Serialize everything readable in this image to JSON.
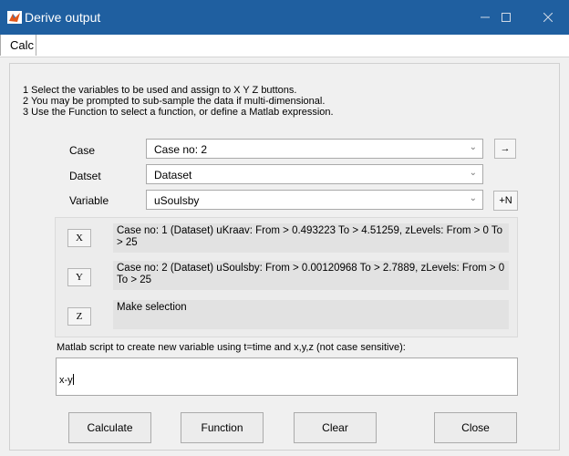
{
  "window": {
    "title": "Derive output",
    "app_icon": "matlab-icon",
    "controls": [
      "minimize-icon",
      "maximize-icon",
      "close-icon"
    ]
  },
  "menu": {
    "items": [
      {
        "label": "Calc"
      }
    ]
  },
  "instructions": [
    "1 Select the variables to be used and assign to X Y Z buttons.",
    "2 You may be prompted to sub-sample the data if multi-dimensional.",
    "3 Use the Function to select a function, or define a Matlab expression."
  ],
  "fields": {
    "case": {
      "label": "Case",
      "value": "Case no: 2",
      "action_label": "→"
    },
    "dataset": {
      "label": "Datset",
      "value": "Dataset"
    },
    "variable": {
      "label": "Variable",
      "value": "uSoulsby",
      "action_label": "+N"
    }
  },
  "xyz": [
    {
      "button": "X",
      "text": "Case no: 1 (Dataset) uKraav: From > 0.493223 To > 4.51259, zLevels: From > 0 To > 25"
    },
    {
      "button": "Y",
      "text": "Case no: 2 (Dataset) uSoulsby: From > 0.00120968 To > 2.7889, zLevels: From > 0 To > 25"
    },
    {
      "button": "Z",
      "text": "Make selection"
    }
  ],
  "script": {
    "label": "Matlab script to create new variable using t=time and x,y,z (not case sensitive):",
    "value": "x-y"
  },
  "buttons": {
    "calculate": "Calculate",
    "function": "Function",
    "clear": "Clear",
    "close": "Close"
  }
}
